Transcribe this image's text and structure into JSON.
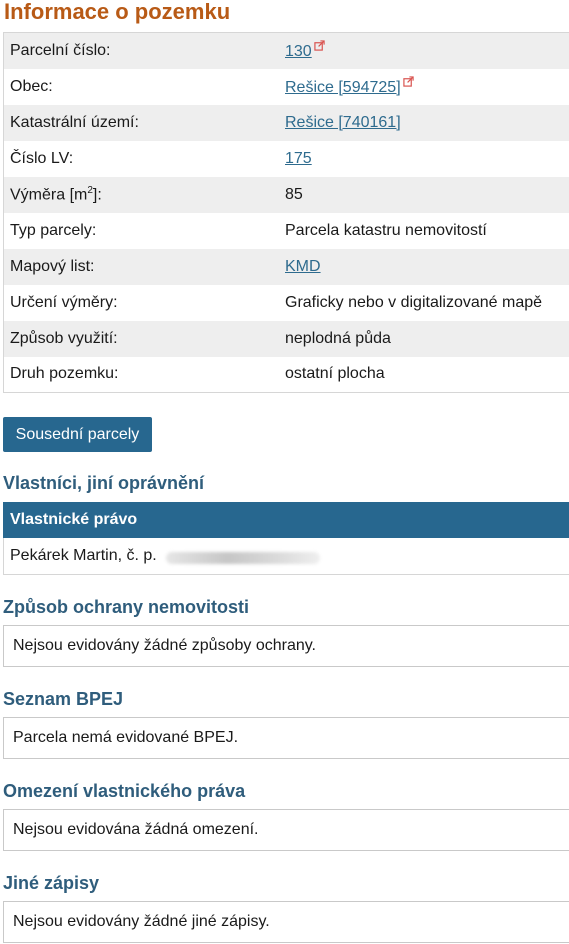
{
  "page_title": "Informace o pozemku",
  "info": {
    "parcel_number": {
      "label": "Parcelní číslo:",
      "value": "130"
    },
    "municipality": {
      "label": "Obec:",
      "value": "Rešice [594725]"
    },
    "cadastral_area": {
      "label": "Katastrální území:",
      "value": "Rešice [740161]"
    },
    "lv_number": {
      "label": "Číslo LV:",
      "value": "175"
    },
    "area": {
      "label_prefix": "Výměra [m",
      "label_sup": "2",
      "label_suffix": "]:",
      "value": "85"
    },
    "parcel_type": {
      "label": "Typ parcely:",
      "value": "Parcela katastru nemovitostí"
    },
    "map_sheet": {
      "label": "Mapový list:",
      "value": "KMD"
    },
    "area_determination": {
      "label": "Určení výměry:",
      "value": "Graficky nebo v digitalizované mapě"
    },
    "usage": {
      "label": "Způsob využití:",
      "value": "neplodná půda"
    },
    "land_type": {
      "label": "Druh pozemku:",
      "value": "ostatní plocha"
    }
  },
  "neighbors_button": "Sousední parcely",
  "owners": {
    "title": "Vlastníci, jiní oprávnění",
    "header": "Vlastnické právo",
    "owner_text": "Pekárek Martin, č. p."
  },
  "protection": {
    "title": "Způsob ochrany nemovitosti",
    "text": "Nejsou evidovány žádné způsoby ochrany."
  },
  "bpej": {
    "title": "Seznam BPEJ",
    "text": "Parcela nemá evidované BPEJ."
  },
  "restrictions": {
    "title": "Omezení vlastnického práva",
    "text": "Nejsou evidována žádná omezení."
  },
  "other_records": {
    "title": "Jiné zápisy",
    "text": "Nejsou evidovány žádné jiné zápisy."
  },
  "colors": {
    "title": "#b85a16",
    "link": "#2e6b8e",
    "accent": "#27678f",
    "section_title": "#2f5d7c",
    "external_icon": "#d9534f"
  },
  "icons": {
    "external_link": "external-link-icon"
  }
}
